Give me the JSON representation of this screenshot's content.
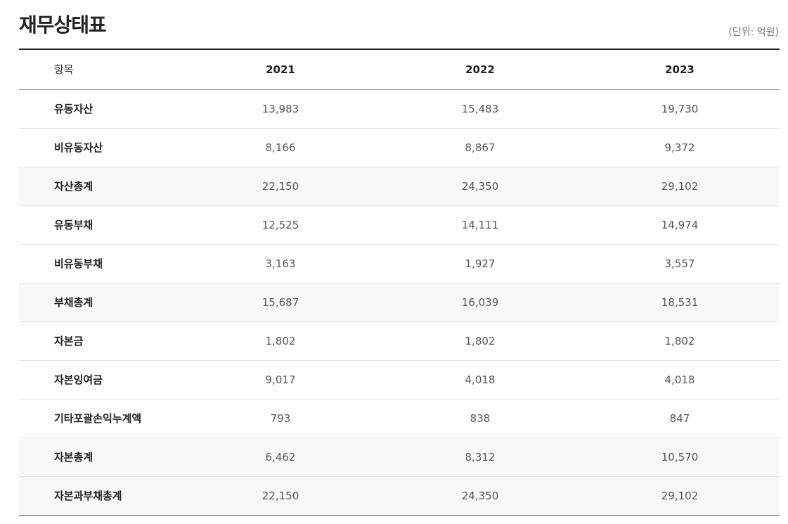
{
  "page": {
    "title": "재무상태표",
    "unit": "(단위: 억원)"
  },
  "table": {
    "headers": [
      "항목",
      "2021",
      "2022",
      "2023"
    ],
    "rows": [
      {
        "label": "유동자산",
        "values": [
          "13,983",
          "15,483",
          "19,730"
        ],
        "total": false
      },
      {
        "label": "비유동자산",
        "values": [
          "8,166",
          "8,867",
          "9,372"
        ],
        "total": false
      },
      {
        "label": "자산총계",
        "values": [
          "22,150",
          "24,350",
          "29,102"
        ],
        "total": true
      },
      {
        "label": "유동부채",
        "values": [
          "12,525",
          "14,111",
          "14,974"
        ],
        "total": false
      },
      {
        "label": "비유동부채",
        "values": [
          "3,163",
          "1,927",
          "3,557"
        ],
        "total": false
      },
      {
        "label": "부채총계",
        "values": [
          "15,687",
          "16,039",
          "18,531"
        ],
        "total": true
      },
      {
        "label": "자본금",
        "values": [
          "1,802",
          "1,802",
          "1,802"
        ],
        "total": false
      },
      {
        "label": "자본잉여금",
        "values": [
          "9,017",
          "4,018",
          "4,018"
        ],
        "total": false
      },
      {
        "label": "기타포괄손익누계액",
        "values": [
          "793",
          "838",
          "847"
        ],
        "total": false
      },
      {
        "label": "자본총계",
        "values": [
          "6,462",
          "8,312",
          "10,570"
        ],
        "total": true
      },
      {
        "label": "자본과부채총계",
        "values": [
          "22,150",
          "24,350",
          "29,102"
        ],
        "total": true
      }
    ]
  }
}
